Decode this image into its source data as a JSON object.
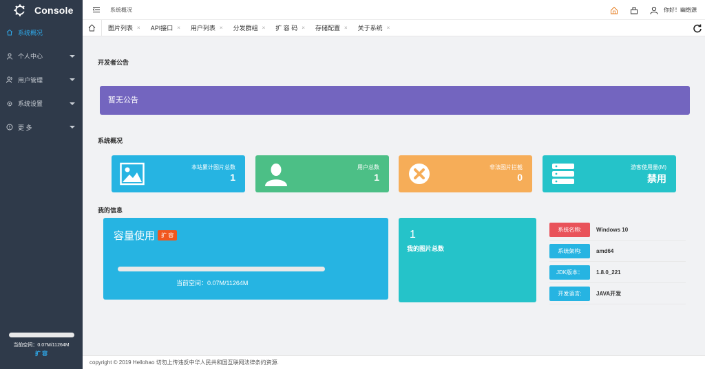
{
  "app": {
    "name": "Console"
  },
  "sidebar": {
    "items": [
      {
        "label": "系统概况",
        "icon": "home-icon",
        "active": true
      },
      {
        "label": "个人中心",
        "icon": "user-icon",
        "active": false
      },
      {
        "label": "用户管理",
        "icon": "users-icon",
        "active": false
      },
      {
        "label": "系统设置",
        "icon": "settings-icon",
        "active": false
      },
      {
        "label": "更 多",
        "icon": "info-icon",
        "active": false
      }
    ],
    "space_text": "当前空间：0.07M/11264M",
    "space_used_fraction": 1e-05,
    "expand_label": "扩 容"
  },
  "header": {
    "breadcrumb": "系统概况",
    "greeting": "你好！幽络源"
  },
  "tabs": [
    {
      "label": "图片列表"
    },
    {
      "label": "API接口"
    },
    {
      "label": "用户列表"
    },
    {
      "label": "分发群组"
    },
    {
      "label": "扩 容 码"
    },
    {
      "label": "存储配置"
    },
    {
      "label": "关于系统"
    }
  ],
  "tab_close": "×",
  "sections": {
    "notice_title": "开发者公告",
    "overview_title": "系统概况",
    "myinfo_title": "我的信息"
  },
  "notice": {
    "text": "暂无公告"
  },
  "stats": [
    {
      "label": "本站累计图片总数",
      "value": "1",
      "color": "#26b4e2",
      "icon": "image-icon"
    },
    {
      "label": "用户总数",
      "value": "1",
      "color": "#4cbf86",
      "icon": "user-silhouette-icon"
    },
    {
      "label": "非法图片拦截",
      "value": "0",
      "color": "#f6ad58",
      "icon": "close-circle-icon"
    },
    {
      "label": "游客使用量(M)",
      "value": "禁用",
      "color": "#25c3c9",
      "icon": "server-icon"
    }
  ],
  "capacity": {
    "title": "容量使用",
    "badge": "扩 容",
    "text": "当前空间：0.07M/11264M",
    "used_fraction": 1e-05
  },
  "my_pictures": {
    "count": "1",
    "label": "我的图片总数"
  },
  "system_info": [
    {
      "key": "系统名称:",
      "value": "Windows 10",
      "color": "#e9535a"
    },
    {
      "key": "系统架构:",
      "value": "amd64",
      "color": "#26b4e2"
    },
    {
      "key": "JDK版本：",
      "value": "1.8.0_221",
      "color": "#26b4e2"
    },
    {
      "key": "开发语言:",
      "value": "JAVA开发",
      "color": "#26b4e2"
    }
  ],
  "footer": {
    "text": "copyright © 2019 Hellohao 切勿上传违反中华人民共和国互联网法律条约资源."
  }
}
